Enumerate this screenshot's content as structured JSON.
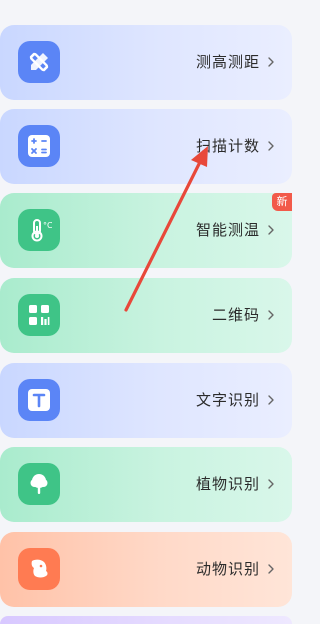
{
  "items": [
    {
      "label": "测高测距",
      "icon": "ruler-pencil-icon"
    },
    {
      "label": "扫描计数",
      "icon": "calculator-icon"
    },
    {
      "label": "智能测温",
      "icon": "thermometer-icon",
      "badge": "新"
    },
    {
      "label": "二维码",
      "icon": "qr-code-icon"
    },
    {
      "label": "文字识别",
      "icon": "text-t-icon"
    },
    {
      "label": "植物识别",
      "icon": "tree-icon"
    },
    {
      "label": "动物识别",
      "icon": "dog-icon"
    }
  ],
  "colors": {
    "blue_accent": "#5b85f6",
    "green_accent": "#3fc487",
    "orange_accent": "#ff7b52",
    "badge_red": "#f25a4a",
    "annotation_arrow": "#e8483a"
  }
}
